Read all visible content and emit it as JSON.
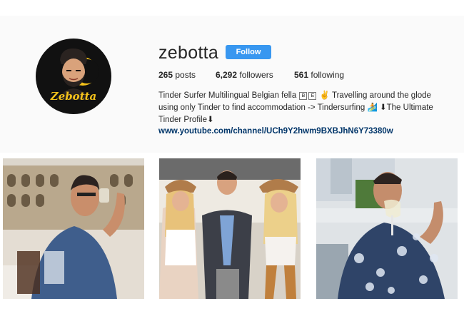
{
  "profile": {
    "username": "zebotta",
    "follow_label": "Follow",
    "avatar_logo_text": "Zebotta",
    "stats": {
      "posts_count": "265",
      "posts_label": "posts",
      "followers_count": "6,292",
      "followers_label": "followers",
      "following_count": "561",
      "following_label": "following"
    },
    "bio": {
      "line1_a": "Tinder Surfer Multilingual Belgian fella",
      "flag1": "B",
      "flag2": "E",
      "emoji1": "✌",
      "line1_b": "Travelling around the glode",
      "line2_a": "using only Tinder to find accommodation -> Tindersurfing",
      "emoji2": "🏄",
      "line2_b": "⬇The Ultimate",
      "line3": "Tinder Profile⬇"
    },
    "link": "www.youtube.com/channel/UCh9Y2hwm9BXBJhN6Y73380w"
  },
  "colors": {
    "accent": "#3897f0",
    "link": "#003569",
    "text": "#262626",
    "panel_bg": "#fafafa",
    "logo_yellow": "#f4c21a"
  },
  "posts": [
    {
      "description": "man drinking at colosseum"
    },
    {
      "description": "man with two cowgirls"
    },
    {
      "description": "man drinking white wine"
    }
  ]
}
